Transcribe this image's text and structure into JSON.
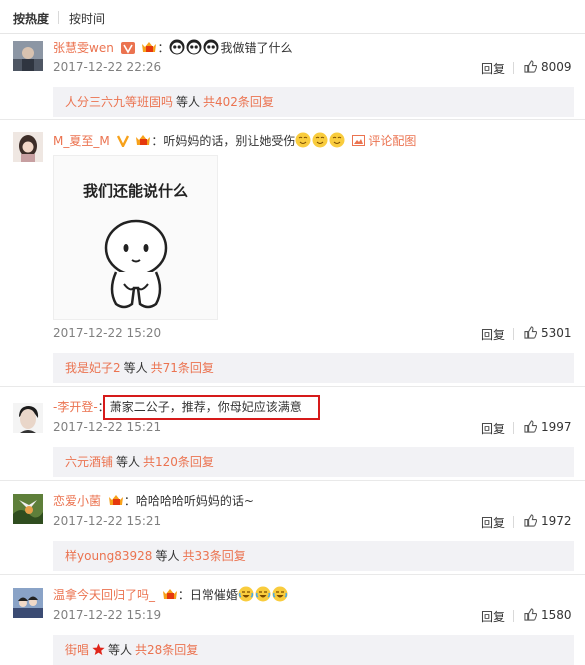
{
  "sort": {
    "tabs": [
      "按热度",
      "按时间"
    ]
  },
  "colors": {
    "accent": "#eb7350",
    "highlight_box": "#d61a1a",
    "sub_bg": "#f2f2f5"
  },
  "actions": {
    "reply_label": "回复"
  },
  "comments": [
    {
      "user": "张慧雯wen",
      "badges": [
        "v-badge-icon",
        "member-crown-icon"
      ],
      "text": "我做错了什么",
      "emoticons": [
        "panda-face-icon",
        "panda-face-icon",
        "panda-face-icon"
      ],
      "time": "2017-12-22 22:26",
      "likes": "8009",
      "sub": {
        "who": "人分三六九等班固吗",
        "mid": "等人",
        "total": "共402条回复"
      }
    },
    {
      "user": "M_夏至_M",
      "badges": [
        "v-badge-icon",
        "member-crown-icon"
      ],
      "text": "听妈妈的话，别让她受伤",
      "emoticons": [
        "yellow-face-icon",
        "yellow-face-icon",
        "yellow-face-icon"
      ],
      "image_link": "评论配图",
      "image_text": "我们还能说什么",
      "time": "2017-12-22 15:20",
      "likes": "5301",
      "sub": {
        "who": "我是妃子2",
        "mid": "等人",
        "total": "共71条回复"
      }
    },
    {
      "user": "-李开登-",
      "text": "萧家二公子，推荐，你母妃应该满意",
      "time": "2017-12-22 15:21",
      "likes": "1997",
      "sub": {
        "who": "六元酒铺",
        "mid": "等人",
        "total": "共120条回复"
      }
    },
    {
      "user": "恋爱小菌",
      "badges": [
        "member-crown-icon"
      ],
      "text": "哈哈哈哈听妈妈的话~",
      "time": "2017-12-22 15:21",
      "likes": "1972",
      "sub": {
        "who": "样young83928",
        "mid": "等人",
        "total": "共33条回复"
      }
    },
    {
      "user": "温拿今天回归了吗_",
      "badges": [
        "member-crown-icon"
      ],
      "text": "日常催婚",
      "emoticons": [
        "laugh-cry-face-icon",
        "laugh-cry-face-icon",
        "laugh-cry-face-icon"
      ],
      "time": "2017-12-22 15:19",
      "likes": "1580",
      "sub": {
        "who": "街唱",
        "who_icon": "red-star-icon",
        "mid": "等人",
        "total": "共28条回复"
      }
    }
  ]
}
